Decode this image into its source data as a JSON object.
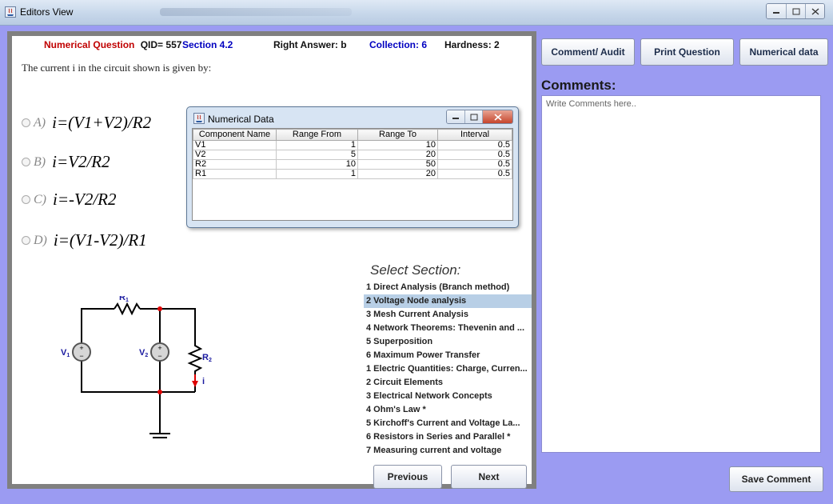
{
  "window": {
    "title": "Editors View"
  },
  "header": {
    "qtype": "Numerical Question",
    "qid": "QID= 557",
    "section": "Section 4.2",
    "right_answer": "Right Answer: b",
    "collection": "Collection: 6",
    "hardness": "Hardness: 2"
  },
  "question": {
    "text": "The current i in the circuit shown is given by:"
  },
  "options": [
    {
      "letter": "A)",
      "formula": "i=(V1+V2)/R2"
    },
    {
      "letter": "B)",
      "formula": "i=V2/R2"
    },
    {
      "letter": "C)",
      "formula": "i=-V2/R2"
    },
    {
      "letter": "D)",
      "formula": "i=(V1-V2)/R1"
    }
  ],
  "circuit": {
    "r1": "R",
    "r1_sub": "1",
    "r2": "R",
    "r2_sub": "2",
    "v1": "V",
    "v1_sub": "1",
    "v2": "V",
    "v2_sub": "2",
    "current": "i"
  },
  "dialog": {
    "title": "Numerical Data",
    "columns": [
      "Component Name",
      "Range From",
      "Range To",
      "Interval"
    ],
    "rows": [
      {
        "name": "V1",
        "from": "1",
        "to": "10",
        "interval": "0.5"
      },
      {
        "name": "V2",
        "from": "5",
        "to": "20",
        "interval": "0.5"
      },
      {
        "name": "R2",
        "from": "10",
        "to": "50",
        "interval": "0.5"
      },
      {
        "name": "R1",
        "from": "1",
        "to": "20",
        "interval": "0.5"
      }
    ]
  },
  "sections": {
    "title": "Select Section:",
    "selected_index": 1,
    "items": [
      "1 Direct  Analysis (Branch method)",
      "2 Voltage Node analysis",
      "3 Mesh Current Analysis",
      "4 Network Theorems: Thevenin and ...",
      "5 Superposition",
      "6 Maximum Power Transfer",
      "1 Electric Quantities: Charge, Curren...",
      "2 Circuit Elements",
      "3  Electrical Network Concepts",
      "4 Ohm's Law *",
      "5 Kirchoff's Current and Voltage La...",
      "6 Resistors in Series and Parallel *",
      "7 Measuring current and voltage"
    ]
  },
  "nav": {
    "previous": "Previous",
    "next": "Next"
  },
  "toolbar": {
    "comment_audit": "Comment/ Audit",
    "print_question": "Print Question",
    "numerical_data": "Numerical data"
  },
  "comments": {
    "label": "Comments:",
    "placeholder": "Write Comments here..",
    "save": "Save Comment"
  },
  "colors": {
    "qtype": "#c00000",
    "header_blue": "#0000c0",
    "background": "#9b9bf2",
    "selection": "#b8cfe6"
  }
}
